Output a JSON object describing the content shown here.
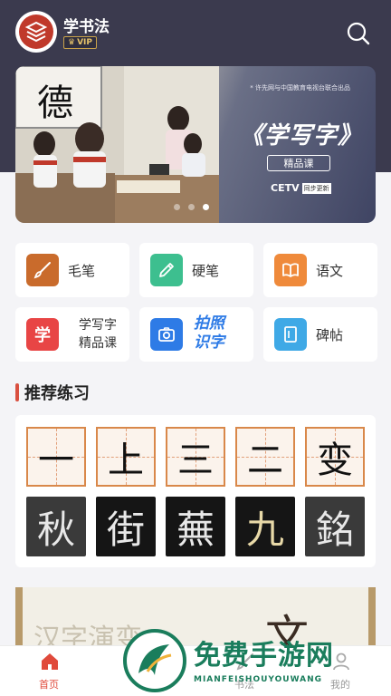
{
  "header": {
    "app_title": "学书法",
    "vip_label": "VIP",
    "search_icon": "search-icon"
  },
  "banner": {
    "note": "* 许先网与中国教育电视台联合出品",
    "title": "《学写字》",
    "subtitle": "精品课",
    "cetv": "CETV",
    "cetv_tag": "同步更新",
    "board_char": "德",
    "dots": 3,
    "active_dot": 3
  },
  "categories": [
    {
      "label": "毛笔",
      "icon": "brush-icon",
      "color": "#c96b2c"
    },
    {
      "label": "硬笔",
      "icon": "pen-icon",
      "color": "#3dbf8f"
    },
    {
      "label": "语文",
      "icon": "book-icon",
      "color": "#ef8a3b"
    },
    {
      "label": "学写字",
      "label2": "精品课",
      "icon": "xue-char-icon",
      "icon_text": "学",
      "color": "#e84545"
    },
    {
      "label": "拍照",
      "label2": "识字",
      "icon": "camera-icon",
      "color": "#2e7be6"
    },
    {
      "label": "碑帖",
      "icon": "tablet-icon",
      "color": "#3fa9e6"
    }
  ],
  "section": {
    "title": "推荐练习"
  },
  "practice": {
    "grid_chars": [
      "一",
      "上",
      "三",
      "二",
      "变"
    ],
    "rubbing_chars": [
      "秋",
      "街",
      "蕪",
      "九",
      "銘"
    ]
  },
  "scroll_banner": {
    "text": "汉字演变",
    "big_char": "文"
  },
  "tabbar": {
    "items": [
      {
        "label": "首页",
        "icon": "home-icon",
        "active": true
      },
      {
        "label": "书法",
        "icon": "brush-icon",
        "active": false
      },
      {
        "label": "我的",
        "icon": "user-icon",
        "active": false
      }
    ]
  },
  "watermark": {
    "title": "免费手游网",
    "sub": "MIANFEISHOUYOUWANG"
  }
}
